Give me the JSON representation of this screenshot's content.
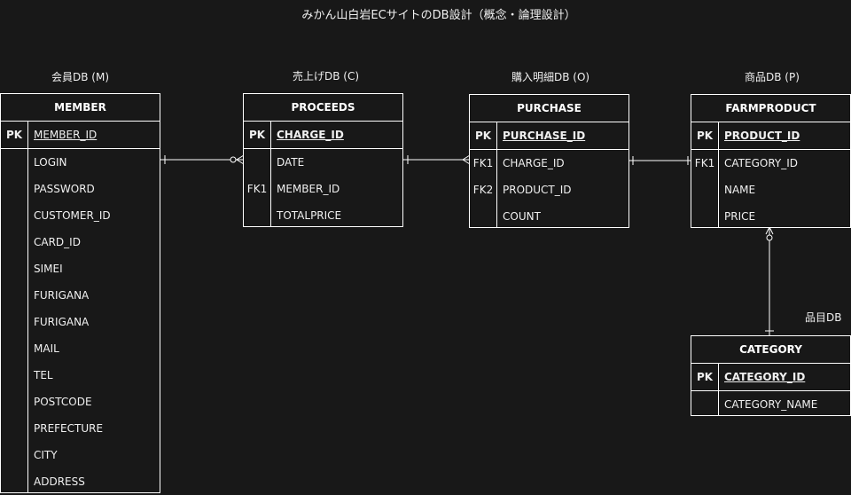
{
  "title": "みかん山白岩ECサイトのDB設計（概念・論理設計）",
  "labels": {
    "member_db": "会員DB (M)",
    "proceeds_db": "売上げDB (C)",
    "purchase_db": "購入明細DB (O)",
    "product_db": "商品DB (P)",
    "category_db": "品目DB"
  },
  "entities": {
    "member": {
      "name": "MEMBER",
      "pk_key": "PK",
      "pk_field": "MEMBER_ID",
      "fields": [
        "LOGIN",
        "PASSWORD",
        "CUSTOMER_ID",
        "CARD_ID",
        "SIMEI",
        "FURIGANA",
        "FURIGANA",
        "MAIL",
        "TEL",
        "POSTCODE",
        "PREFECTURE",
        "CITY",
        "ADDRESS"
      ]
    },
    "proceeds": {
      "name": "PROCEEDS",
      "pk_key": "PK",
      "pk_field": "CHARGE_ID",
      "fields": [
        {
          "key": "",
          "name": "DATE"
        },
        {
          "key": "FK1",
          "name": "MEMBER_ID"
        },
        {
          "key": "",
          "name": "TOTALPRICE"
        }
      ]
    },
    "purchase": {
      "name": "PURCHASE",
      "pk_key": "PK",
      "pk_field": "PURCHASE_ID",
      "fields": [
        {
          "key": "FK1",
          "name": "CHARGE_ID"
        },
        {
          "key": "FK2",
          "name": "PRODUCT_ID"
        },
        {
          "key": "",
          "name": "COUNT"
        }
      ]
    },
    "farmproduct": {
      "name": "FARMPRODUCT",
      "pk_key": "PK",
      "pk_field": "PRODUCT_ID",
      "fields": [
        {
          "key": "FK1",
          "name": "CATEGORY_ID"
        },
        {
          "key": "",
          "name": "NAME"
        },
        {
          "key": "",
          "name": "PRICE"
        }
      ]
    },
    "category": {
      "name": "CATEGORY",
      "pk_key": "PK",
      "pk_field": "CATEGORY_ID",
      "fields": [
        {
          "key": "",
          "name": "CATEGORY_NAME"
        }
      ]
    }
  },
  "colors": {
    "background": "#181818",
    "line": "#ffffff",
    "text": "#f0f0f0"
  }
}
